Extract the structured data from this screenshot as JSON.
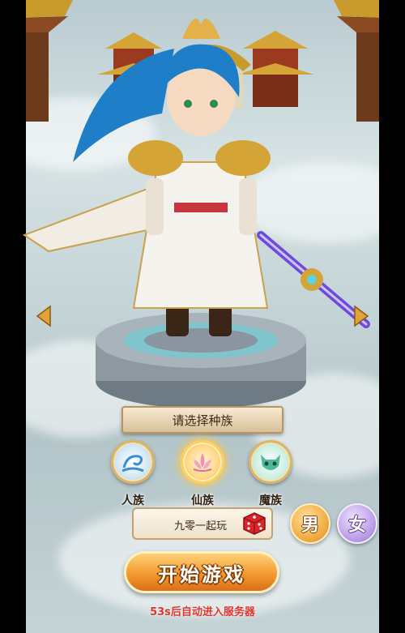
{
  "header": {
    "select_race_label": "请选择种族"
  },
  "races": [
    {
      "id": "human",
      "label": "人族",
      "icon": "swirl-wave-icon",
      "color": "#5aa3d8"
    },
    {
      "id": "immortal",
      "label": "仙族",
      "icon": "lotus-icon",
      "color": "#f08fb0"
    },
    {
      "id": "demon",
      "label": "魔族",
      "icon": "demon-mask-icon",
      "color": "#4fb89a"
    }
  ],
  "selected_race": "仙族",
  "character_name": {
    "value": "九零一起玩",
    "randomize_icon": "dice-icon"
  },
  "gender": {
    "male_label": "男",
    "female_label": "女",
    "selected": "男"
  },
  "start_button": {
    "label": "开始游戏"
  },
  "auto_enter": {
    "text": "53s后自动进入服务器"
  },
  "colors": {
    "accent_orange": "#f29a2e",
    "countdown_red": "#e2352b",
    "gold_border": "#d9b56a"
  }
}
